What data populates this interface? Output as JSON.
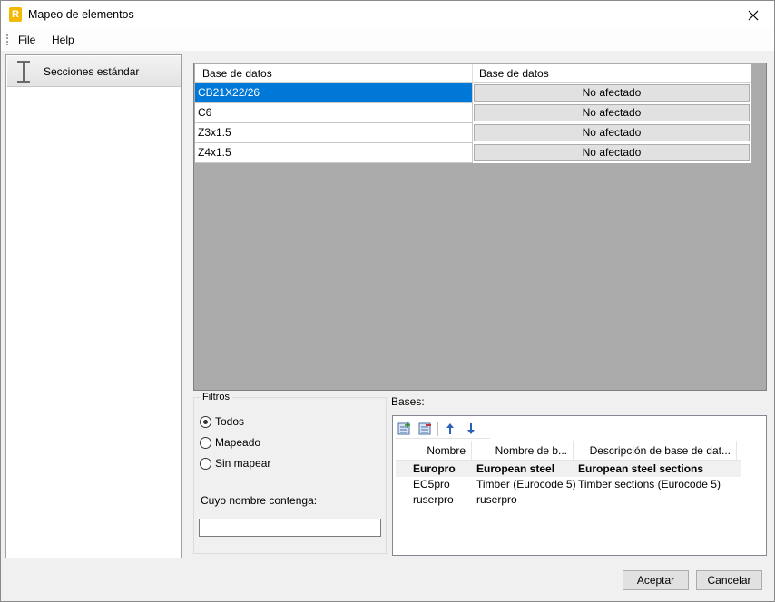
{
  "window": {
    "title": "Mapeo de elementos",
    "icon_letter": "R"
  },
  "menu": {
    "items": [
      {
        "label": "File"
      },
      {
        "label": "Help"
      }
    ]
  },
  "sidebar": {
    "items": [
      {
        "label": "Secciones estándar",
        "icon": "i-beam-icon"
      }
    ]
  },
  "grid": {
    "headers": [
      "Base de datos",
      "Base de datos"
    ],
    "rows": [
      {
        "name": "CB21X22/26",
        "mapping": "No afectado",
        "selected": true
      },
      {
        "name": "C6",
        "mapping": "No afectado",
        "selected": false
      },
      {
        "name": "Z3x1.5",
        "mapping": "No afectado",
        "selected": false
      },
      {
        "name": "Z4x1.5",
        "mapping": "No afectado",
        "selected": false
      }
    ]
  },
  "filters": {
    "legend": "Filtros",
    "options": [
      {
        "label": "Todos",
        "checked": true
      },
      {
        "label": "Mapeado",
        "checked": false
      },
      {
        "label": "Sin mapear",
        "checked": false
      }
    ],
    "name_label": "Cuyo nombre contenga:",
    "name_value": ""
  },
  "bases": {
    "label": "Bases:",
    "toolbar": [
      "add-database-icon",
      "remove-database-icon",
      "move-up-icon",
      "move-down-icon"
    ],
    "columns": [
      "Nombre",
      "Nombre de b...",
      "Descripción de base de dat..."
    ],
    "rows": [
      {
        "name": "Europro",
        "db_name": "European steel",
        "description": "European steel sections",
        "bold": true
      },
      {
        "name": "EC5pro",
        "db_name": "Timber (Eurocode 5)",
        "description": "Timber sections (Eurocode 5)",
        "bold": false
      },
      {
        "name": "ruserpro",
        "db_name": "ruserpro",
        "description": "",
        "bold": false
      }
    ]
  },
  "buttons": {
    "accept": "Aceptar",
    "cancel": "Cancelar"
  }
}
